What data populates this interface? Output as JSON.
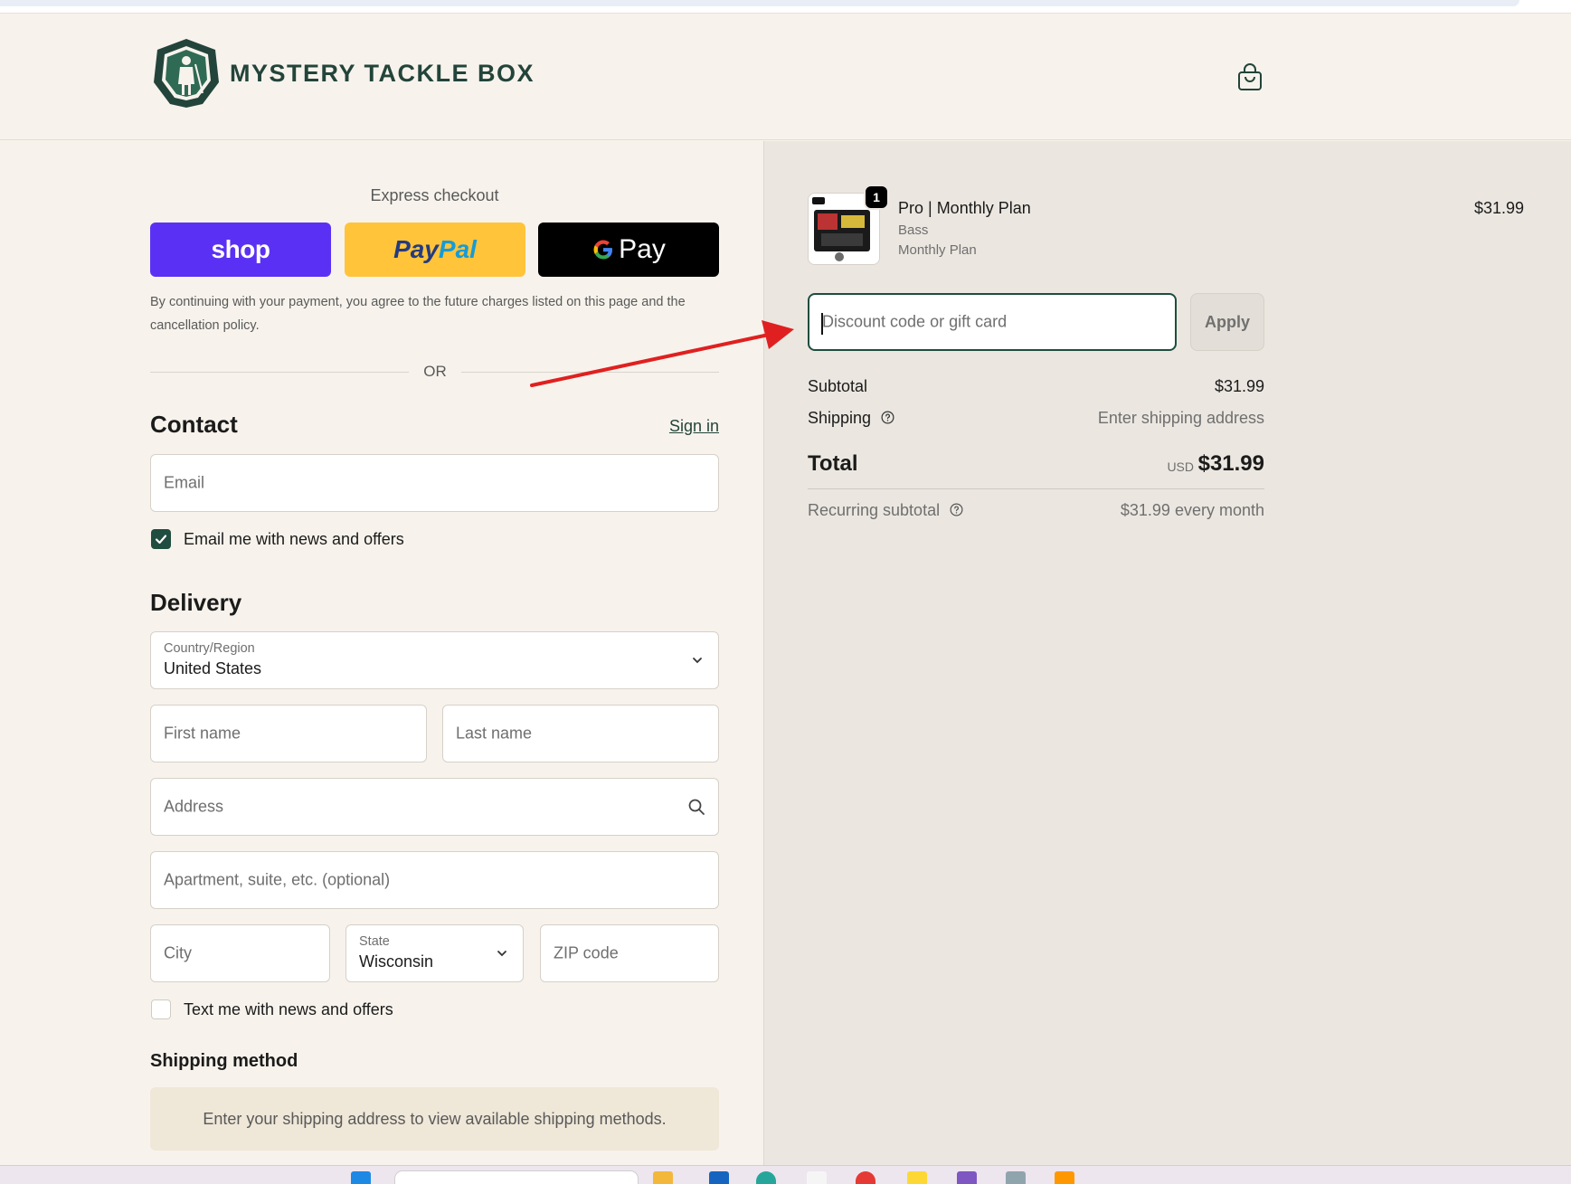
{
  "brand": {
    "name": "MYSTERY TACKLE BOX"
  },
  "express": {
    "label": "Express checkout",
    "shop_label": "shop",
    "paypal_label_1": "Pay",
    "paypal_label_2": "Pal",
    "gpay_label_g": "G",
    "gpay_label_pay": "Pay",
    "disclaimer": "By continuing with your payment, you agree to the future charges listed on this page and the cancellation policy.",
    "or_label": "OR"
  },
  "contact": {
    "title": "Contact",
    "sign_in": "Sign in",
    "email_placeholder": "Email",
    "news_label": "Email me with news and offers",
    "news_checked": true
  },
  "delivery": {
    "title": "Delivery",
    "country_label": "Country/Region",
    "country_value": "United States",
    "first_name_placeholder": "First name",
    "last_name_placeholder": "Last name",
    "address_placeholder": "Address",
    "apartment_placeholder": "Apartment, suite, etc. (optional)",
    "city_placeholder": "City",
    "state_label": "State",
    "state_value": "Wisconsin",
    "zip_placeholder": "ZIP code",
    "text_label": "Text me with news and offers",
    "text_checked": false
  },
  "shipping_method": {
    "title": "Shipping method",
    "message": "Enter your shipping address to view available shipping methods."
  },
  "order": {
    "product_name": "Pro | Monthly Plan",
    "variant_1": "Bass",
    "variant_2": "Monthly Plan",
    "quantity": "1",
    "price": "$31.99",
    "discount_placeholder": "Discount code or gift card",
    "apply_label": "Apply",
    "subtotal_label": "Subtotal",
    "subtotal_value": "$31.99",
    "shipping_label": "Shipping",
    "shipping_value": "Enter shipping address",
    "total_label": "Total",
    "total_currency": "USD",
    "total_value": "$31.99",
    "recurring_label": "Recurring subtotal",
    "recurring_value": "$31.99 every month"
  },
  "colors": {
    "brand_green": "#1f4d3f",
    "shop_purple": "#5a31f4",
    "paypal_yellow": "#ffc439",
    "annotation_arrow": "#e02020"
  },
  "icons": [
    "logo-shield-icon",
    "shopping-bag-icon",
    "google-g-icon",
    "checkmark-icon",
    "chevron-down-icon",
    "search-icon",
    "help-circle-icon",
    "annotation-arrow-icon"
  ]
}
